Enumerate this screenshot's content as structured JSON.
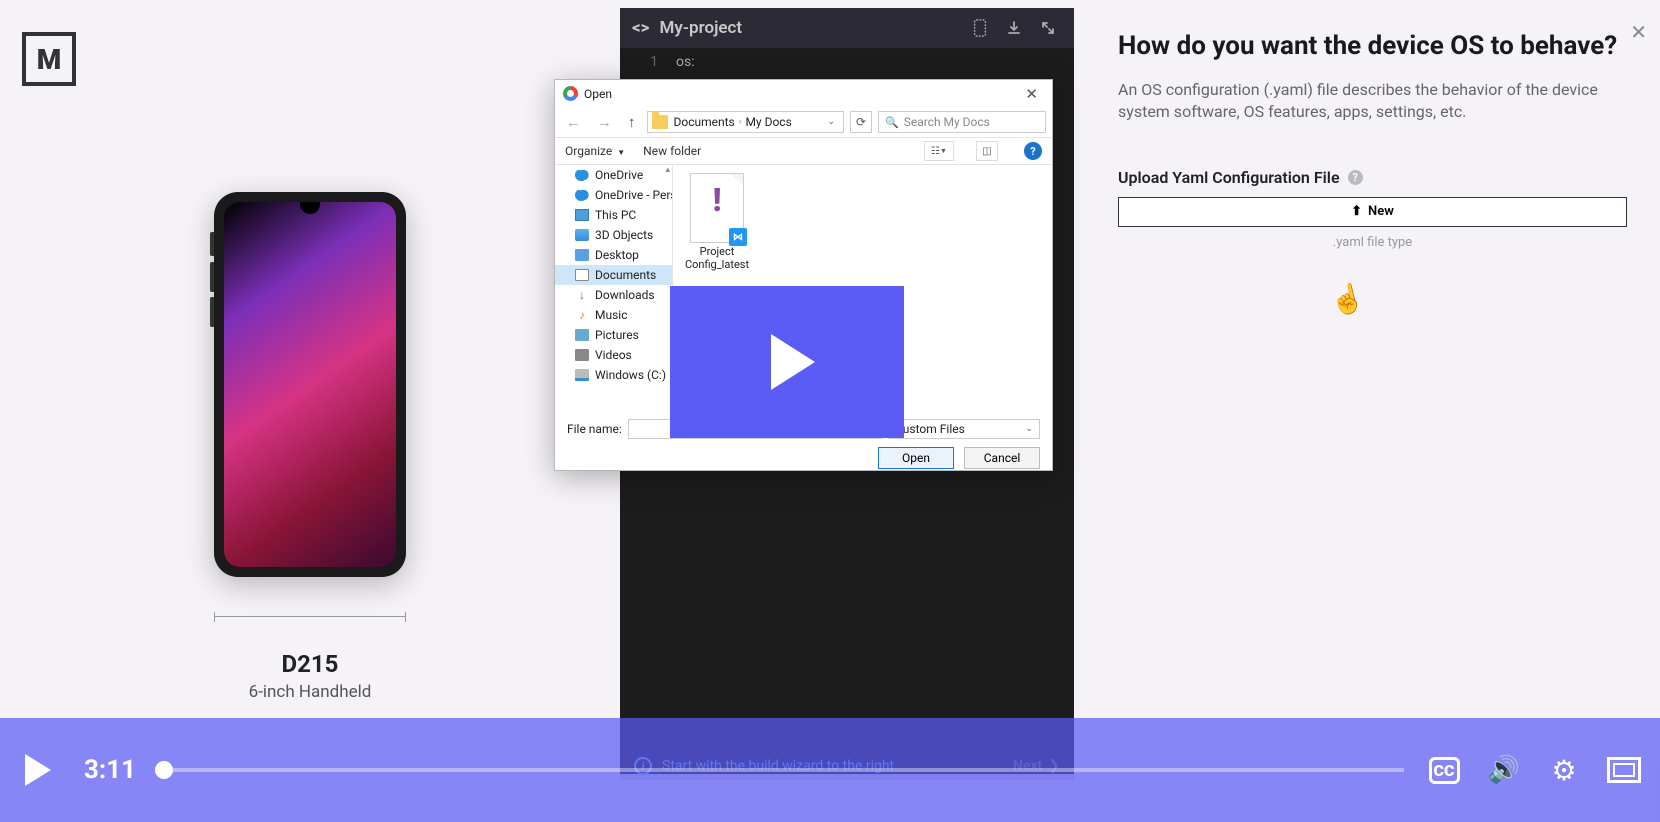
{
  "logo": "M",
  "device": {
    "name": "D215",
    "subtitle": "6-inch Handheld"
  },
  "editor": {
    "projectName": "My-project",
    "lineNum": "1",
    "code": "os:",
    "footerHint": "Start with the build wizard to the right",
    "nextLabel": "Next"
  },
  "rightPanel": {
    "heading": "How do you want the device OS to behave?",
    "description": "An OS configuration (.yaml) file describes the behavior of the device system software, OS features, apps, settings, etc.",
    "uploadLabel": "Upload Yaml Configuration File",
    "uploadButton": "New",
    "uploadHint": ".yaml file type"
  },
  "dialog": {
    "title": "Open",
    "breadcrumb": [
      "Documents",
      "My Docs"
    ],
    "searchPlaceholder": "Search My Docs",
    "organize": "Organize",
    "newFolder": "New folder",
    "tree": [
      {
        "label": "OneDrive",
        "icon": "cloud"
      },
      {
        "label": "OneDrive - Person",
        "icon": "cloud"
      },
      {
        "label": "This PC",
        "icon": "pc"
      },
      {
        "label": "3D Objects",
        "icon": "threeD"
      },
      {
        "label": "Desktop",
        "icon": "desktop"
      },
      {
        "label": "Documents",
        "icon": "doc",
        "selected": true
      },
      {
        "label": "Downloads",
        "icon": "dl"
      },
      {
        "label": "Music",
        "icon": "music"
      },
      {
        "label": "Pictures",
        "icon": "pic"
      },
      {
        "label": "Videos",
        "icon": "vid"
      },
      {
        "label": "Windows (C:)",
        "icon": "drive"
      }
    ],
    "file": {
      "name": "Project Config_latest"
    },
    "fileNameLabel": "File name:",
    "fileTypeFilter": "Custom Files",
    "openBtn": "Open",
    "cancelBtn": "Cancel"
  },
  "video": {
    "time": "3:11",
    "ccLabel": "CC"
  }
}
